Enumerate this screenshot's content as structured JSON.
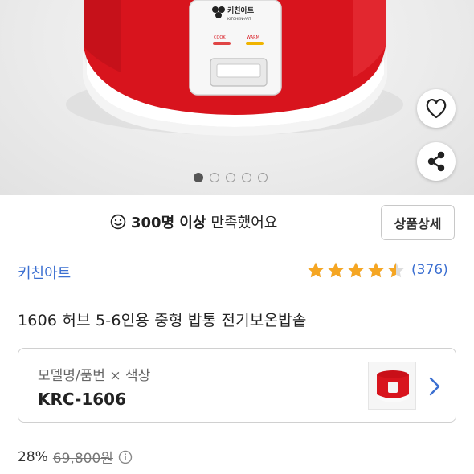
{
  "hero": {
    "image_label": "rice-cooker-product-photo",
    "cooker_brand": "키친아트",
    "cooker_brand_sub": "KITCHEN-ART",
    "cook_label": "COOK",
    "warm_label": "WARM",
    "carousel": {
      "total": 5,
      "active_index": 0
    },
    "like_icon": "heart-outline-icon",
    "share_icon": "share-icon"
  },
  "satisfaction": {
    "icon": "smile-icon",
    "count_text": "300명 이상",
    "suffix_text": "만족했어요"
  },
  "detail_button": {
    "label": "상품상세"
  },
  "brand": {
    "name": "키친아트"
  },
  "rating": {
    "stars": 4.5,
    "max": 5,
    "count_text": "(376)"
  },
  "product": {
    "title": "1606 허브 5-6인용 중형 밥통 전기보온밥솥"
  },
  "option": {
    "label": "모델명/품번 × 색상",
    "value": "KRC-1606",
    "chevron_icon": "chevron-right-icon"
  },
  "price": {
    "discount": "28%",
    "original": "69,800원",
    "info_icon": "info-icon"
  },
  "colors": {
    "accent": "#3b6fd1",
    "star": "#f5a623",
    "cooker_red": "#d8141d"
  }
}
